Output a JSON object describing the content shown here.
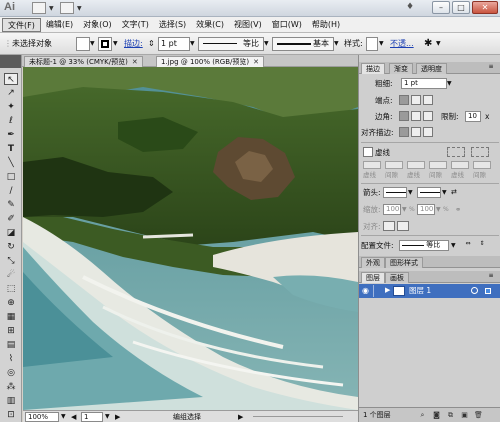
{
  "app": {
    "logo": "Ai"
  },
  "window": {
    "min": "–",
    "max": "□",
    "close": "✕",
    "lamp": "♦"
  },
  "menu": [
    "文件(F)",
    "编辑(E)",
    "对象(O)",
    "文字(T)",
    "选择(S)",
    "效果(C)",
    "视图(V)",
    "窗口(W)",
    "帮助(H)"
  ],
  "control": {
    "selection": "未选择对象",
    "stroke_link": "描边:",
    "stroke_weight": "1 pt",
    "profile": "等比",
    "brush": "基本",
    "style": "样式:",
    "opacity_link": "不透..."
  },
  "tabs": [
    {
      "label": "未标题-1 @ 33% (CMYK/预览)",
      "close": "✕"
    },
    {
      "label": "1.jpg @ 100% (RGB/预览)",
      "close": "✕"
    }
  ],
  "statusbar": {
    "zoom": "100%",
    "page": "1",
    "status": "编组选择"
  },
  "stroke_panel": {
    "tabs": [
      "描边",
      "渐变",
      "透明度"
    ],
    "weight_label": "粗细:",
    "weight": "1 pt",
    "cap_label": "端点:",
    "corner_label": "边角:",
    "limit_label": "限制:",
    "limit": "10",
    "limit_unit": "x",
    "align_label": "对齐描边:",
    "dashed_label": "虚线",
    "dash_labels": [
      "虚线",
      "间隙",
      "虚线",
      "间隙",
      "虚线",
      "间隙"
    ],
    "arrow_label": "箭头:",
    "scale_label": "缩放:",
    "scale_start": "100",
    "scale_end": "100",
    "align_arrow_label": "对齐:",
    "profile_label": "配置文件:",
    "profile": "等比"
  },
  "appearance_tabs": [
    "外观",
    "图形样式"
  ],
  "layers_panel": {
    "tabs": [
      "图层",
      "画板"
    ],
    "layer_name": "图层 1",
    "count": "1 个图层"
  }
}
